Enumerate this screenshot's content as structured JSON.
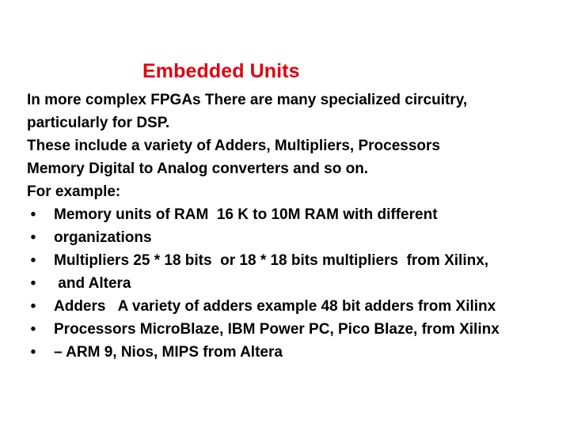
{
  "slide": {
    "title": "Embedded Units",
    "title_color": "#e3000f",
    "paragraph_lines": [
      "In more complex FPGAs There are many specialized circuitry,",
      "particularly for DSP.",
      "These include a variety of Adders, Multipliers, Processors",
      "Memory  Digital to Analog converters and so on.",
      "For example:"
    ],
    "bullet_glyph": "•",
    "bullets": [
      "Memory units of RAM  16 K to 10M RAM with different",
      "organizations",
      "Multipliers 25 * 18 bits  or 18 * 18 bits multipliers  from Xilinx,",
      " and Altera",
      "Adders   A variety of adders example 48 bit adders from Xilinx",
      "Processors MicroBlaze, IBM Power PC, Pico Blaze, from Xilinx",
      "– ARM 9, Nios, MIPS from Altera"
    ]
  }
}
